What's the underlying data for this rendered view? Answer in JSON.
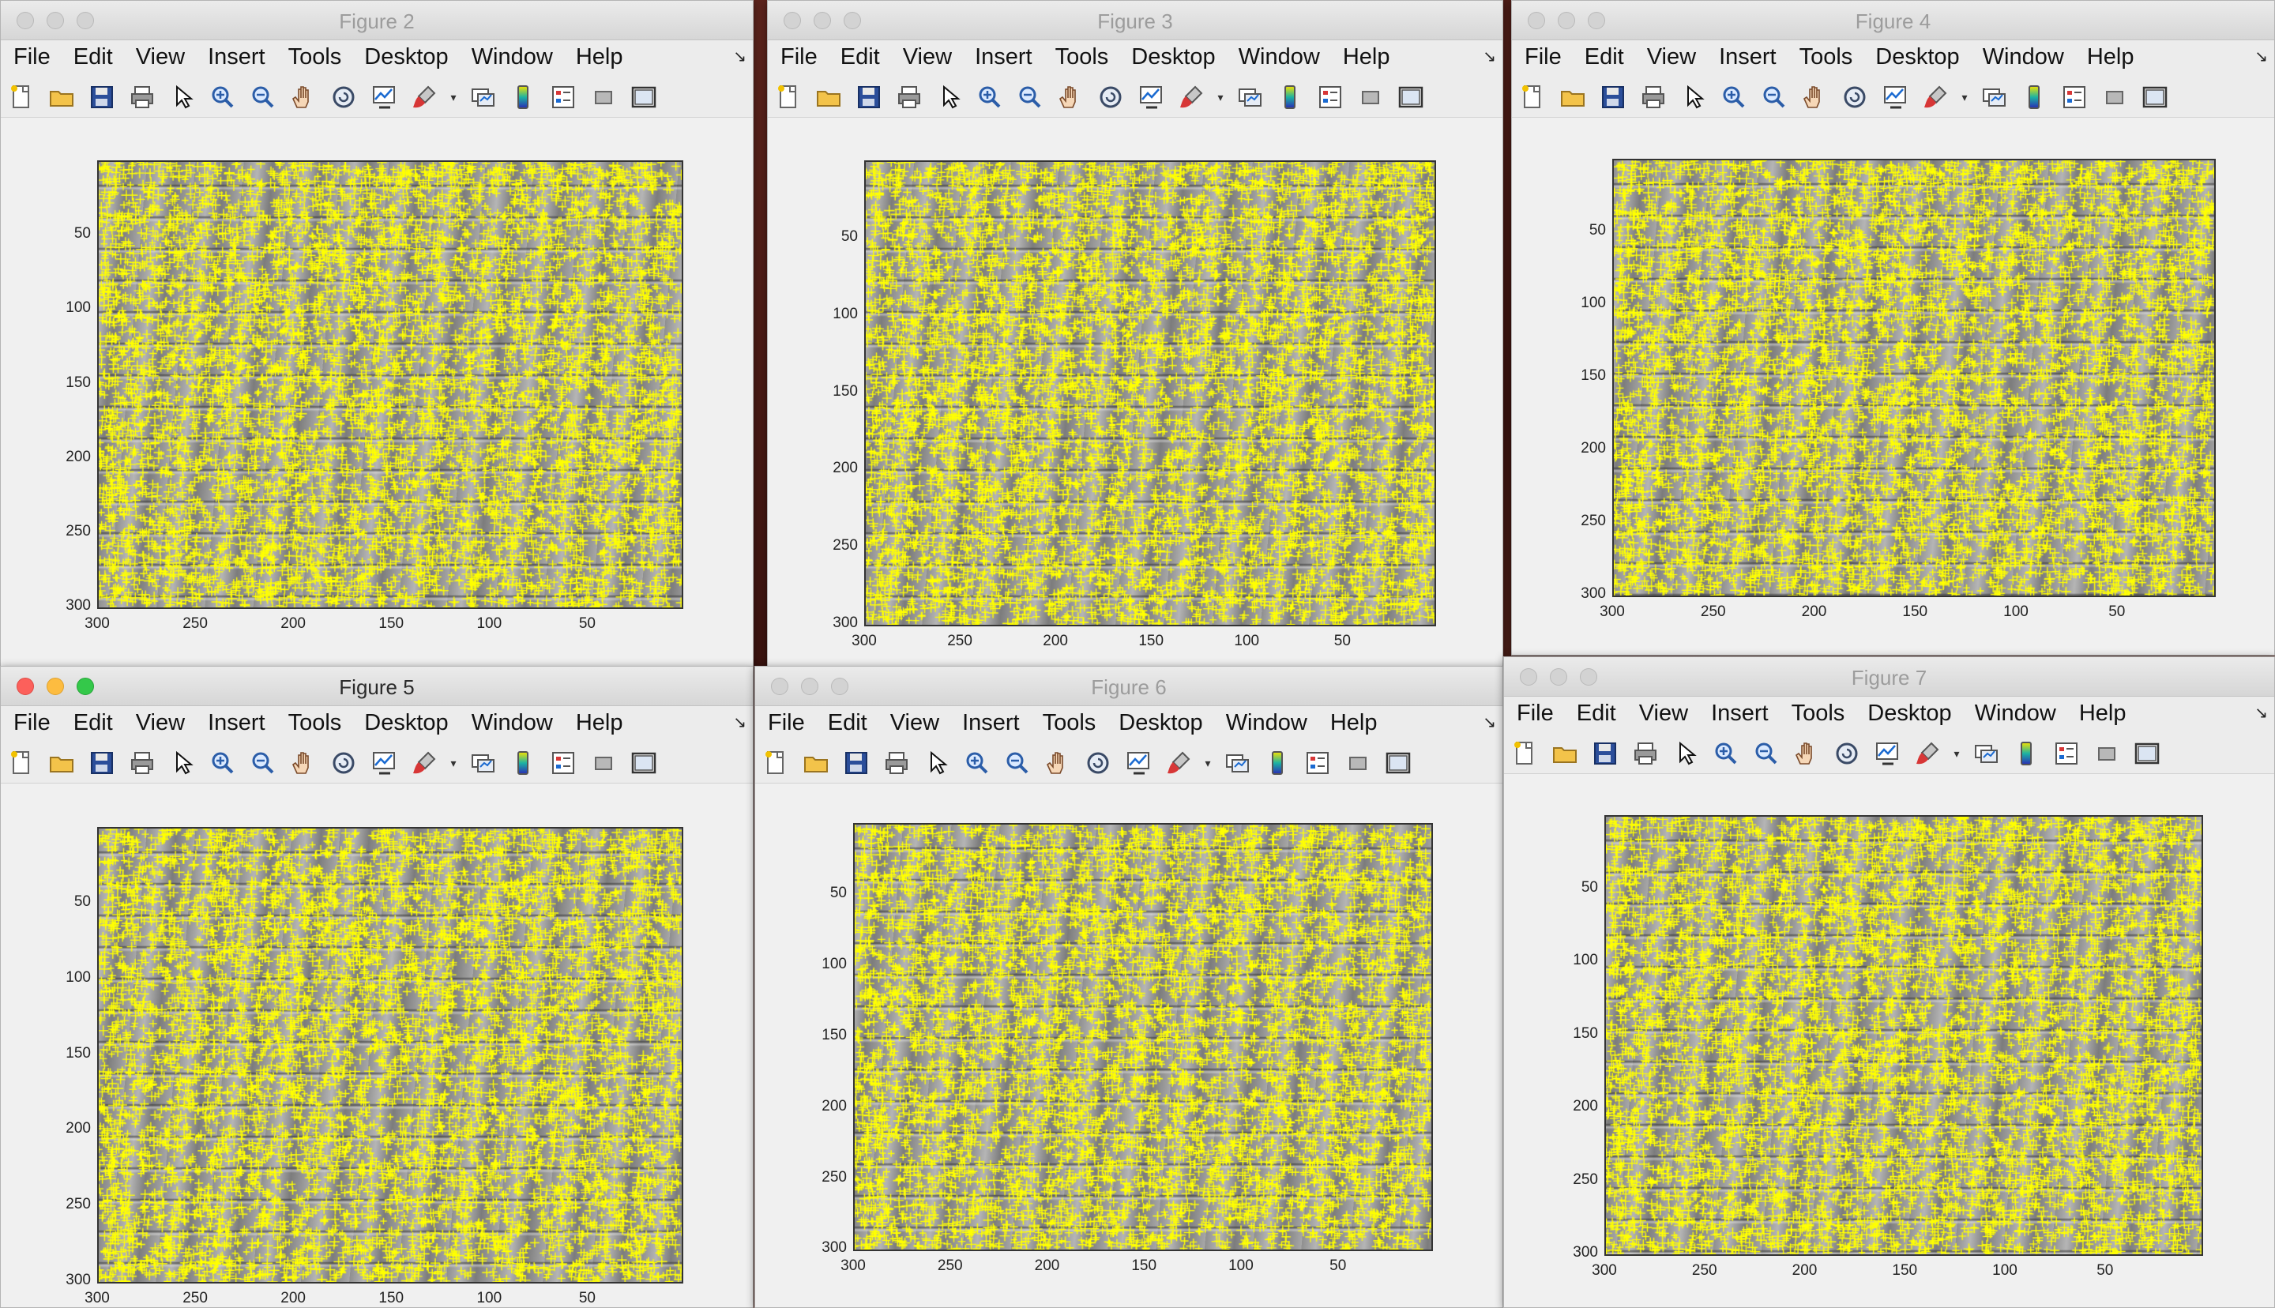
{
  "menu_labels": [
    "File",
    "Edit",
    "View",
    "Insert",
    "Tools",
    "Desktop",
    "Window",
    "Help"
  ],
  "toolbar_icons": [
    "new-figure-icon",
    "open-file-icon",
    "save-icon",
    "print-icon",
    "edit-plot-arrow-icon",
    "zoom-in-icon",
    "zoom-out-icon",
    "pan-hand-icon",
    "rotate-3d-icon",
    "data-cursor-icon",
    "brush-icon",
    "link-plot-icon",
    "colorbar-icon",
    "legend-icon",
    "hide-plot-tools-icon",
    "show-plot-tools-icon"
  ],
  "menu_overflow_glyph": "↘",
  "marker_color": "#ffff00",
  "windows": [
    {
      "title": "Figure 2",
      "active": false,
      "y_ticks": [
        "50",
        "100",
        "150",
        "200",
        "250",
        "300"
      ],
      "x_ticks": [
        "300",
        "250",
        "200",
        "150",
        "100",
        "50"
      ]
    },
    {
      "title": "Figure 3",
      "active": false,
      "y_ticks": [
        "50",
        "100",
        "150",
        "200",
        "250",
        "300"
      ],
      "x_ticks": [
        "300",
        "250",
        "200",
        "150",
        "100",
        "50"
      ]
    },
    {
      "title": "Figure 4",
      "active": false,
      "y_ticks": [
        "50",
        "100",
        "150",
        "200",
        "250",
        "300"
      ],
      "x_ticks": [
        "300",
        "250",
        "200",
        "150",
        "100",
        "50"
      ]
    },
    {
      "title": "Figure 5",
      "active": true,
      "y_ticks": [
        "50",
        "100",
        "150",
        "200",
        "250",
        "300"
      ],
      "x_ticks": [
        "300",
        "250",
        "200",
        "150",
        "100",
        "50"
      ]
    },
    {
      "title": "Figure 6",
      "active": false,
      "y_ticks": [
        "50",
        "100",
        "150",
        "200",
        "250",
        "300"
      ],
      "x_ticks": [
        "300",
        "250",
        "200",
        "150",
        "100",
        "50"
      ]
    },
    {
      "title": "Figure 7",
      "active": false,
      "y_ticks": [
        "50",
        "100",
        "150",
        "200",
        "250",
        "300"
      ],
      "x_ticks": [
        "300",
        "250",
        "200",
        "150",
        "100",
        "50"
      ]
    }
  ]
}
